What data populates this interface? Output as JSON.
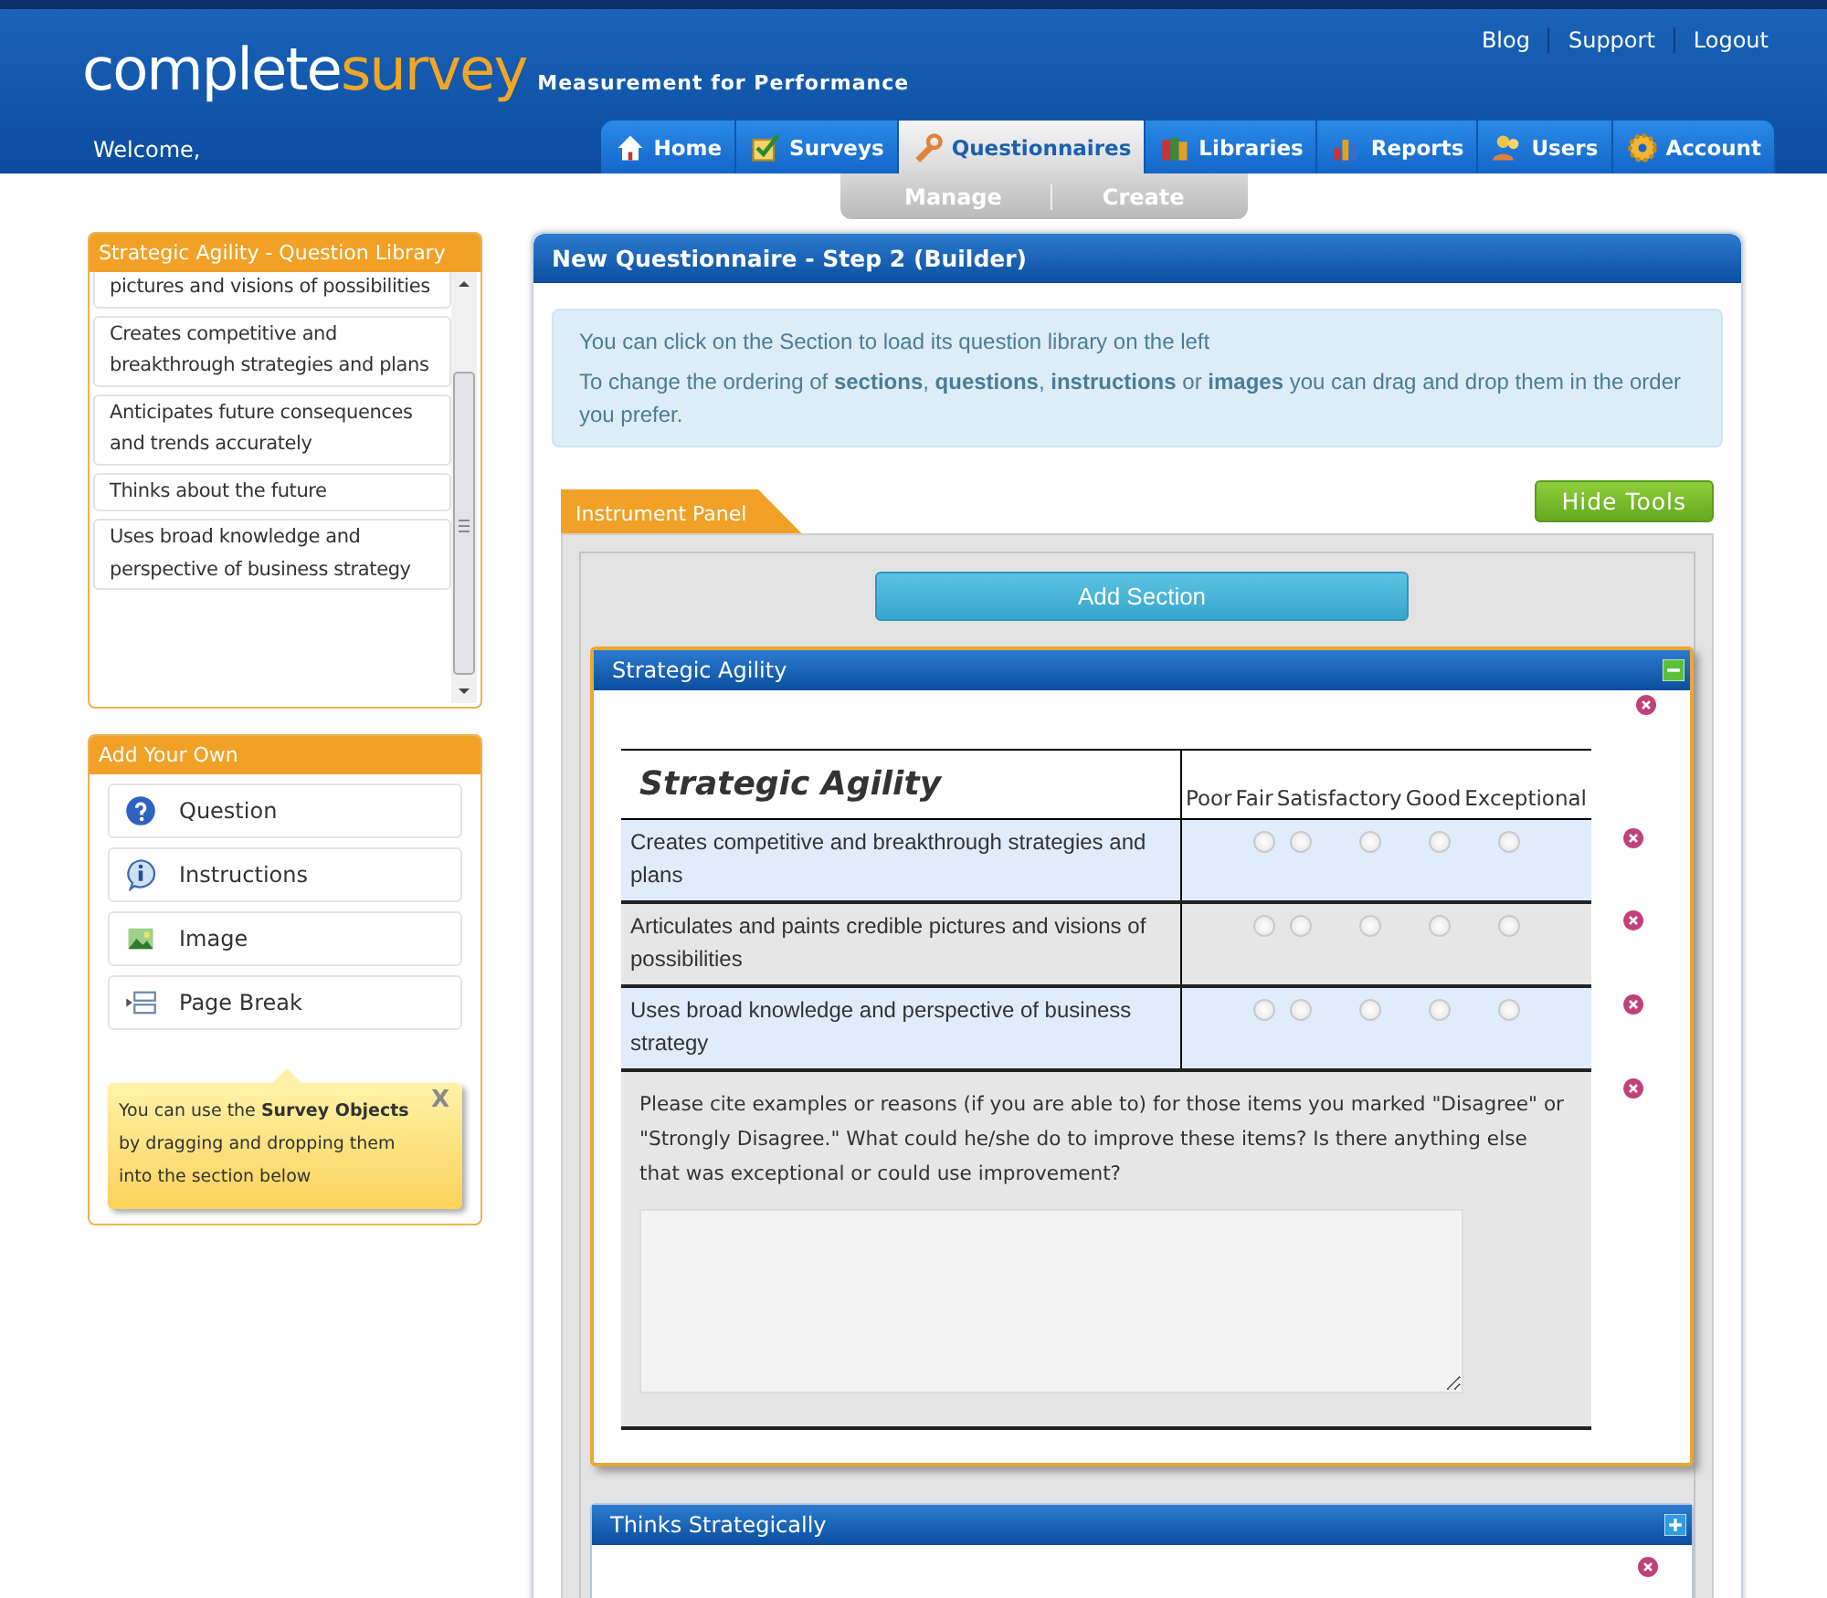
{
  "header": {
    "logo_part1": "complete",
    "logo_part2": "survey",
    "tagline": "Measurement for Performance",
    "welcome": "Welcome,",
    "top_links": [
      "Blog",
      "Support",
      "Logout"
    ]
  },
  "nav": [
    {
      "label": "Home",
      "selected": false
    },
    {
      "label": "Surveys",
      "selected": false
    },
    {
      "label": "Questionnaires",
      "selected": true
    },
    {
      "label": "Libraries",
      "selected": false
    },
    {
      "label": "Reports",
      "selected": false
    },
    {
      "label": "Users",
      "selected": false
    },
    {
      "label": "Account",
      "selected": false
    }
  ],
  "subnav": [
    "Manage",
    "Create"
  ],
  "library": {
    "title": "Strategic Agility - Question Library",
    "items": [
      "pictures and visions of possibilities",
      "Creates competitive and breakthrough strategies and plans",
      "Anticipates future consequences and trends accurately",
      "Thinks about the future",
      "Uses broad knowledge and perspective of business strategy"
    ]
  },
  "add_your_own": {
    "title": "Add Your Own",
    "items": [
      "Question",
      "Instructions",
      "Image",
      "Page Break"
    ],
    "tip": "You can use the **Survey Objects** by dragging and dropping them into the section below",
    "tip_close": "X"
  },
  "builder": {
    "title": "New Questionnaire - Step 2 (Builder)",
    "info": [
      "You can click on the Section to load its question library on the left",
      "To change the ordering of **sections**, **questions**, **instructions** or **images** you can drag and drop them in the order you prefer."
    ],
    "hide_tools": "Hide Tools",
    "instrument_tab": "Instrument Panel",
    "add_section": "Add Section",
    "sections": [
      {
        "title": "Strategic Agility",
        "expanded": true,
        "table_title": "Strategic Agility",
        "scale": [
          "Poor",
          "Fair",
          "Satisfactory",
          "Good",
          "Exceptional"
        ],
        "questions": [
          {
            "text": "Creates competitive and breakthrough strategies and plans",
            "options": [
              {
                "selected": false
              },
              {
                "selected": false
              },
              {
                "selected": false
              },
              {
                "selected": false
              },
              {
                "selected": false
              }
            ]
          },
          {
            "text": "Articulates and paints credible pictures and visions of possibilities",
            "options": [
              {
                "selected": false
              },
              {
                "selected": false
              },
              {
                "selected": false
              },
              {
                "selected": false
              },
              {
                "selected": false
              }
            ]
          },
          {
            "text": "Uses broad knowledge and perspective of business strategy",
            "options": [
              {
                "selected": false
              },
              {
                "selected": false
              },
              {
                "selected": false
              },
              {
                "selected": false
              },
              {
                "selected": false
              }
            ]
          }
        ],
        "comment": "Please cite examples or reasons (if you are able to) for those items you marked \"Disagree\" or \"Strongly Disagree.\" What could he/she do to improve these items? Is there anything else that was exceptional or could use improvement?"
      },
      {
        "title": "Thinks Strategically",
        "expanded": false
      }
    ]
  }
}
